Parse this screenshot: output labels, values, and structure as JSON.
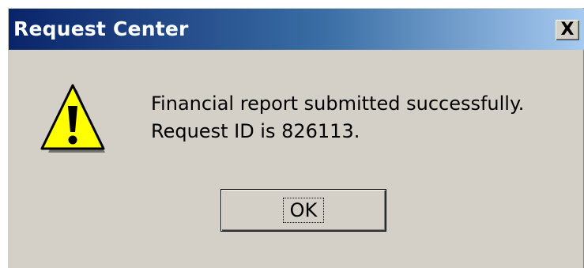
{
  "window": {
    "title": "Request Center",
    "close_label": "X"
  },
  "message": {
    "line1": "Financial report submitted successfully.",
    "line2": "Request ID is 826113."
  },
  "buttons": {
    "ok_label": "OK"
  },
  "icons": {
    "warning": "warning-icon",
    "close": "close-icon"
  },
  "colors": {
    "titlebar_start": "#0a246a",
    "titlebar_end": "#a6caf0",
    "dialog_face": "#d4d0c8",
    "warning_fill": "#ffff00"
  }
}
